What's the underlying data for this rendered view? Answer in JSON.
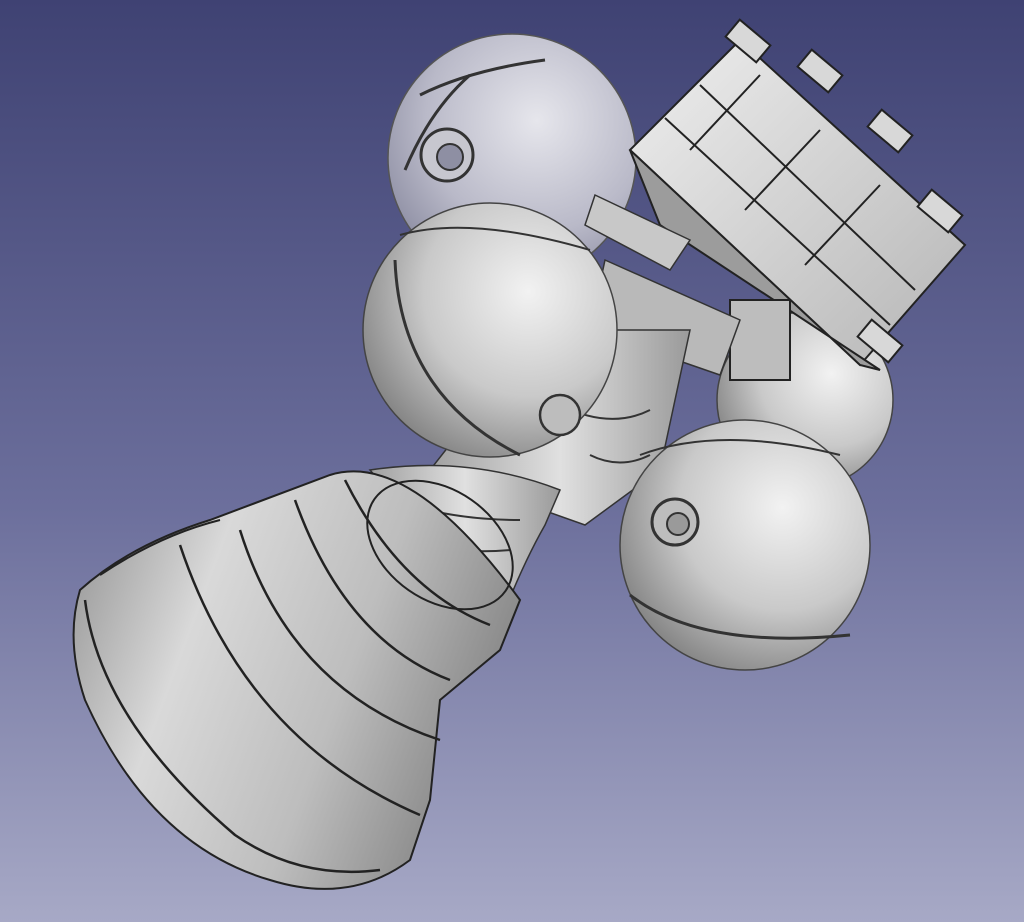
{
  "viewport": {
    "background_top": "#3f4273",
    "background_bottom": "#a7a9c6",
    "model_color": "#cfcfcf",
    "edge_color": "#2a2a2a"
  },
  "model": {
    "parts": [
      "nozzle-bell",
      "throat",
      "combustion-chamber",
      "sphere-tank-back-left",
      "sphere-tank-front-left",
      "sphere-tank-back-right",
      "sphere-tank-front-right",
      "turbopump-block"
    ]
  }
}
